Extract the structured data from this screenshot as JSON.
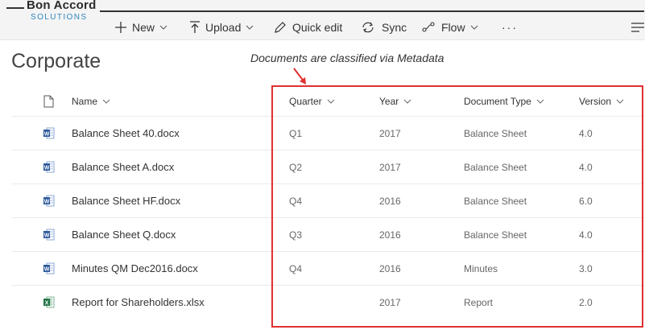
{
  "logo": {
    "title": "Bon Accord",
    "subtitle": "SOLUTIONS"
  },
  "toolbar": {
    "new_label": "New",
    "upload_label": "Upload",
    "quick_edit_label": "Quick edit",
    "sync_label": "Sync",
    "flow_label": "Flow",
    "more_label": "···"
  },
  "page": {
    "title": "Corporate"
  },
  "annotation": {
    "text": "Documents are classified via Metadata",
    "color": "#e03131"
  },
  "columns": {
    "name": "Name",
    "quarter": "Quarter",
    "year": "Year",
    "doc_type": "Document Type",
    "version": "Version"
  },
  "rows": [
    {
      "icon": "word-doc-icon",
      "name": "Balance Sheet 40.docx",
      "quarter": "Q1",
      "year": "2017",
      "doc_type": "Balance Sheet",
      "version": "4.0"
    },
    {
      "icon": "word-doc-icon",
      "name": "Balance Sheet A.docx",
      "quarter": "Q2",
      "year": "2017",
      "doc_type": "Balance Sheet",
      "version": "4.0"
    },
    {
      "icon": "word-doc-icon",
      "name": "Balance Sheet HF.docx",
      "quarter": "Q4",
      "year": "2016",
      "doc_type": "Balance Sheet",
      "version": "6.0"
    },
    {
      "icon": "word-doc-icon",
      "name": "Balance Sheet Q.docx",
      "quarter": "Q3",
      "year": "2016",
      "doc_type": "Balance Sheet",
      "version": "4.0"
    },
    {
      "icon": "word-doc-icon",
      "name": "Minutes QM Dec2016.docx",
      "quarter": "Q4",
      "year": "2016",
      "doc_type": "Minutes",
      "version": "3.0"
    },
    {
      "icon": "excel-doc-icon",
      "name": "Report for Shareholders.xlsx",
      "quarter": "",
      "year": "2017",
      "doc_type": "Report",
      "version": "2.0"
    }
  ],
  "colors": {
    "word": "#2b579a",
    "excel": "#217346",
    "highlight": "#e03131",
    "logo_accent": "#2e86c1"
  }
}
